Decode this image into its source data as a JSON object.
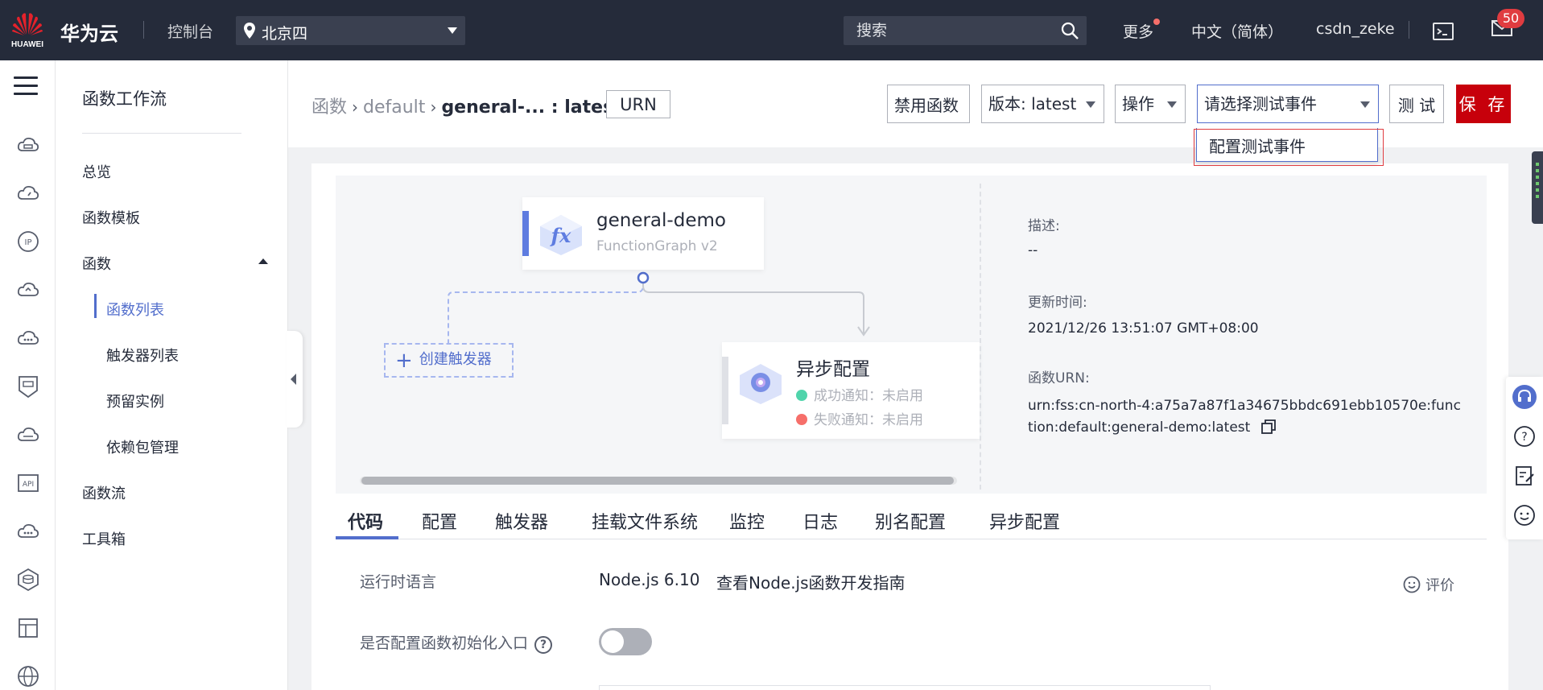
{
  "topbar": {
    "logo_text": "HUAWEI",
    "brand": "华为云",
    "console": "控制台",
    "region": "北京四",
    "search_placeholder": "搜索",
    "more": "更多",
    "language": "中文（简体）",
    "username": "csdn_zeke",
    "message_count": "50"
  },
  "nav": {
    "title": "函数工作流",
    "items": [
      {
        "label": "总览"
      },
      {
        "label": "函数模板"
      },
      {
        "label": "函数"
      },
      {
        "label": "函数流"
      },
      {
        "label": "工具箱"
      }
    ],
    "sub_items": [
      {
        "label": "函数列表"
      },
      {
        "label": "触发器列表"
      },
      {
        "label": "预留实例"
      },
      {
        "label": "依赖包管理"
      }
    ]
  },
  "header": {
    "breadcrumb_root": "函数",
    "breadcrumb_app": "default",
    "breadcrumb_current": "general-... : latest",
    "urn_button": "URN",
    "disable_button": "禁用函数",
    "version_select": "版本: latest",
    "operations_select": "操作",
    "test_event_select": "请选择测试事件",
    "test_button": "测 试",
    "save_button": "保 存",
    "dropdown_option": "配置测试事件"
  },
  "flow": {
    "function_name": "general-demo",
    "function_runtime": "FunctionGraph v2",
    "create_trigger": "创建触发器",
    "async_title": "异步配置",
    "success_notify": "成功通知：未启用",
    "failure_notify": "失败通知：未启用",
    "success_color": "#50d4ab",
    "failure_color": "#f66f6a"
  },
  "info": {
    "description_label": "描述:",
    "description_value": "--",
    "updated_label": "更新时间:",
    "updated_value": "2021/12/26 13:51:07 GMT+08:00",
    "urn_label": "函数URN:",
    "urn_value": "urn:fss:cn-north-4:a75a7a87f1a34675bbdc691ebb10570e:function:default:general-demo:latest"
  },
  "tabs": [
    {
      "label": "代码"
    },
    {
      "label": "配置"
    },
    {
      "label": "触发器"
    },
    {
      "label": "挂载文件系统"
    },
    {
      "label": "监控"
    },
    {
      "label": "日志"
    },
    {
      "label": "别名配置"
    },
    {
      "label": "异步配置"
    }
  ],
  "code": {
    "runtime_label": "运行时语言",
    "runtime_value": "Node.js 6.10",
    "guide_link": "查看Node.js函数开发指南",
    "rate": "评价",
    "init_label": "是否配置函数初始化入口",
    "init_enabled": false
  },
  "colors": {
    "accent": "#526ecc",
    "save_red": "#c7000b",
    "topbar": "#252b3a"
  }
}
